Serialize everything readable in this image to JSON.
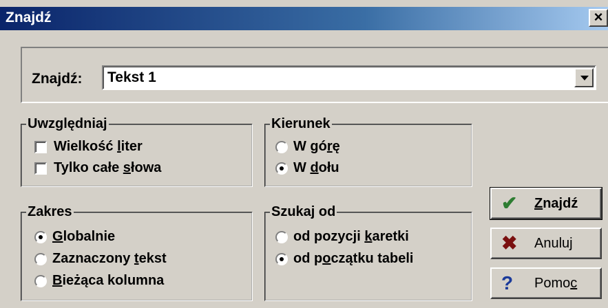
{
  "window": {
    "title": "Znajdź",
    "close_glyph": "×"
  },
  "search": {
    "label_pre": "Zna",
    "label_u": "j",
    "label_post": "dź:",
    "value": "Tekst 1"
  },
  "groups": {
    "uwzgledniaj": {
      "title": "Uwzględniaj",
      "options": [
        {
          "pre": "Wielkość ",
          "u": "l",
          "post": "iter",
          "checked": false
        },
        {
          "pre": "Tylko całe ",
          "u": "s",
          "post": "łowa",
          "checked": false
        }
      ]
    },
    "kierunek": {
      "title": "Kierunek",
      "options": [
        {
          "pre": "W gó",
          "u": "r",
          "post": "ę",
          "selected": false
        },
        {
          "pre": "W ",
          "u": "d",
          "post": "ołu",
          "selected": true
        }
      ]
    },
    "zakres": {
      "title": "Zakres",
      "options": [
        {
          "pre": "",
          "u": "G",
          "post": "lobalnie",
          "selected": true
        },
        {
          "pre": "Zaznaczony ",
          "u": "t",
          "post": "ekst",
          "selected": false
        },
        {
          "pre": "",
          "u": "B",
          "post": "ieżąca kolumna",
          "selected": false
        }
      ]
    },
    "szukaj_od": {
      "title": "Szukaj od",
      "options": [
        {
          "pre": "od pozycji ",
          "u": "k",
          "post": "aretki",
          "selected": false
        },
        {
          "pre": "od p",
          "u": "o",
          "post": "czątku tabeli",
          "selected": true
        }
      ]
    }
  },
  "buttons": {
    "find": {
      "pre": "",
      "u": "Z",
      "post": "najdź",
      "icon": "checkmark-icon",
      "glyph": "✔",
      "color": "#2e7d32"
    },
    "cancel": {
      "pre": "Anuluj",
      "u": "",
      "post": "",
      "icon": "x-icon",
      "glyph": "✖",
      "color": "#7a1010"
    },
    "help": {
      "pre": "Pomo",
      "u": "c",
      "post": "",
      "icon": "question-icon",
      "glyph": "?",
      "color": "#1a3a9a"
    }
  }
}
